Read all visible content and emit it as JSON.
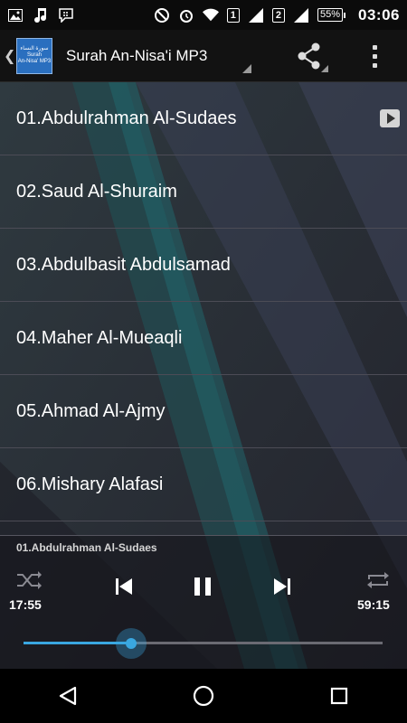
{
  "status_bar": {
    "time": "03:06",
    "battery": "55%",
    "sim1": "1",
    "sim2": "2",
    "icons": [
      "image-icon",
      "music-note-icon",
      "bbm-icon",
      "do-not-disturb-icon",
      "alarm-icon",
      "wifi-icon",
      "signal-icon",
      "signal-icon",
      "battery-icon"
    ]
  },
  "action_bar": {
    "logo_arabic": "سورة النساء",
    "logo_line1": "Surah",
    "logo_line2": "An-Nisa' MP3",
    "title": "Surah An-Nisa'i MP3",
    "icons": [
      "back-chevron-icon",
      "share-icon",
      "more-vert-icon"
    ]
  },
  "tracks": [
    {
      "label": "01.Abdulrahman Al-Sudaes",
      "playing": true
    },
    {
      "label": "02.Saud Al-Shuraim"
    },
    {
      "label": "03.Abdulbasit Abdulsamad"
    },
    {
      "label": "04.Maher Al-Mueaqli"
    },
    {
      "label": "05.Ahmad Al-Ajmy"
    },
    {
      "label": "06.Mishary Alafasi"
    }
  ],
  "player": {
    "now_playing": "01.Abdulrahman Al-Sudaes",
    "elapsed": "17:55",
    "total": "59:15",
    "progress": 0.3,
    "controls": [
      "shuffle-icon",
      "previous-icon",
      "pause-icon",
      "next-icon",
      "repeat-icon"
    ]
  },
  "colors": {
    "accent": "#3aa7e0",
    "list_bg": "#2b2b36",
    "action_bar": "#121212"
  },
  "nav_bar": {
    "icons": [
      "back-triangle-icon",
      "home-icon",
      "recents-icon"
    ]
  }
}
